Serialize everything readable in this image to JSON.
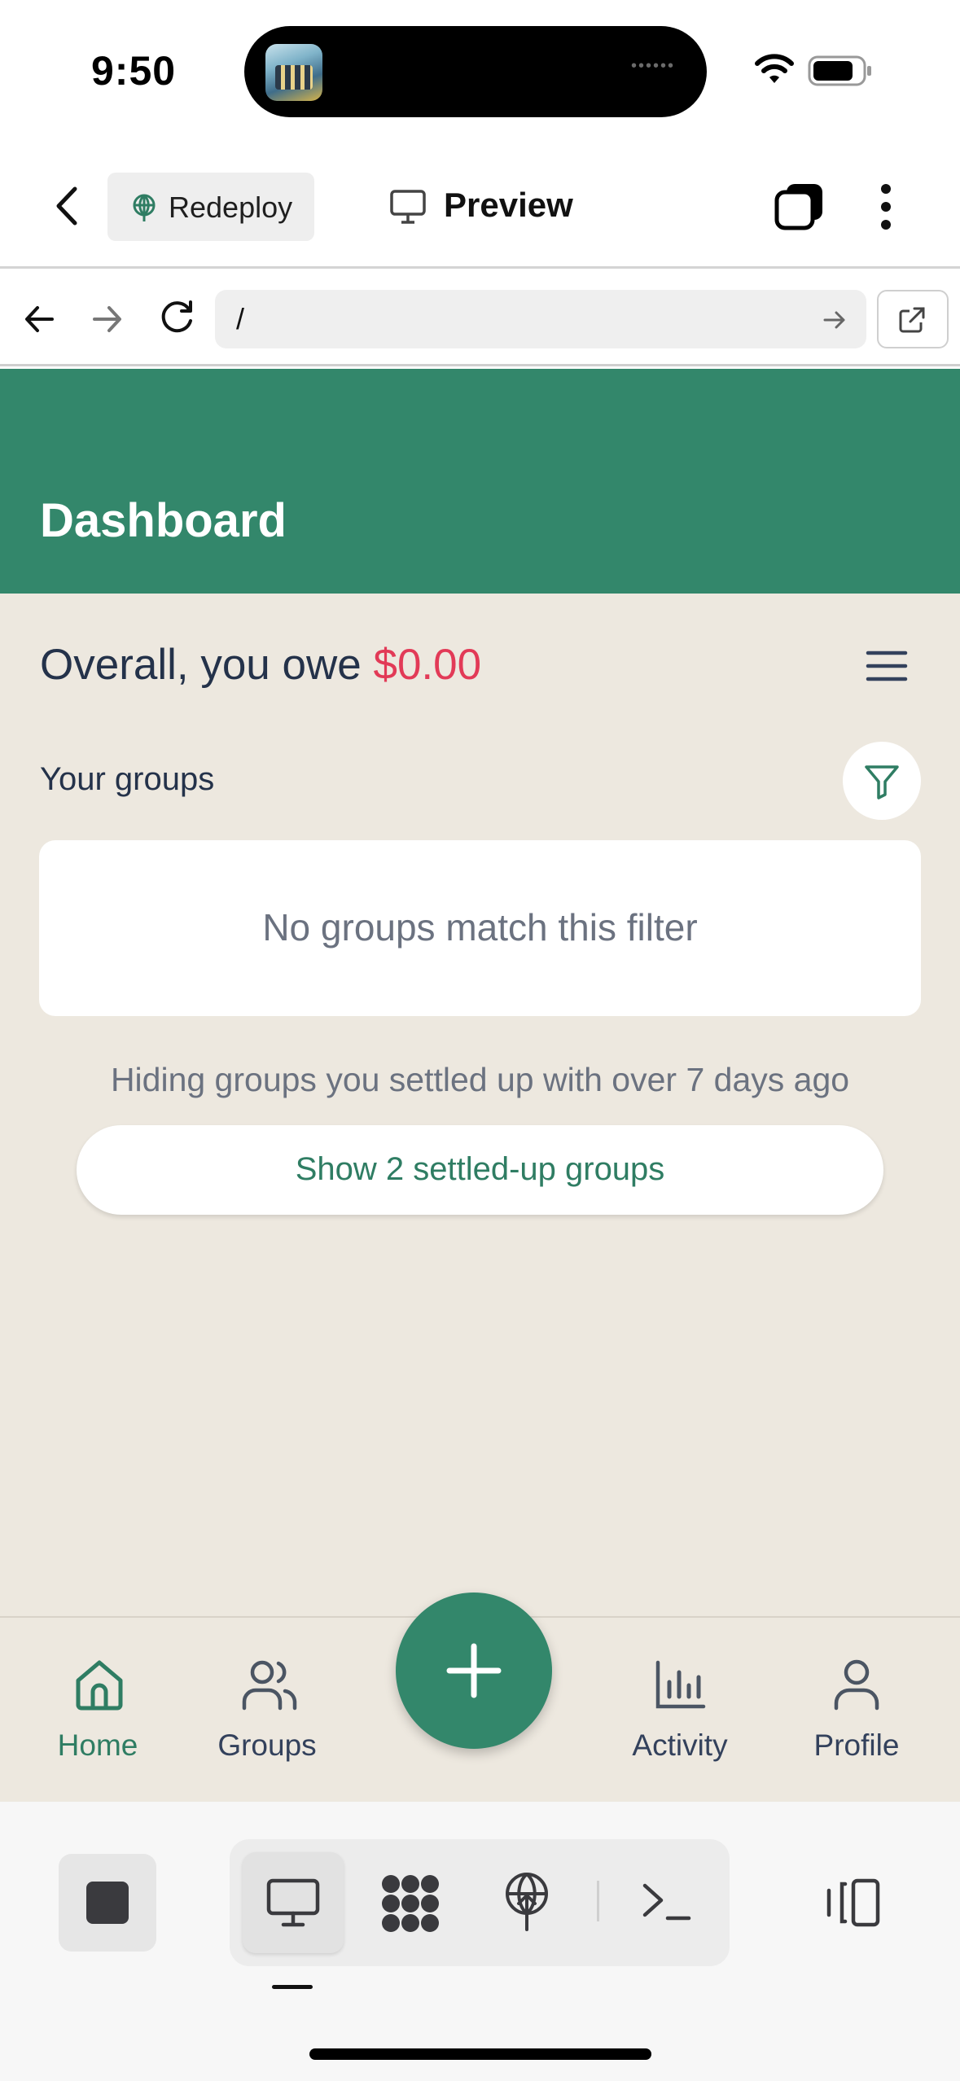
{
  "status_bar": {
    "time": "9:50"
  },
  "toolbar": {
    "redeploy_label": "Redeploy",
    "preview_label": "Preview"
  },
  "browser": {
    "url": "/"
  },
  "header": {
    "title": "Dashboard"
  },
  "summary": {
    "prefix": "Overall, you owe ",
    "amount": "$0.00"
  },
  "groups": {
    "heading": "Your groups",
    "empty_message": "No groups match this filter",
    "hiding_note": "Hiding groups you settled up with over 7 days ago",
    "show_settled_label": "Show 2 settled-up groups"
  },
  "bottom_nav": {
    "items": [
      {
        "label": "Home",
        "icon": "home-icon",
        "active": true
      },
      {
        "label": "Groups",
        "icon": "users-icon",
        "active": false
      },
      {
        "label": "Activity",
        "icon": "bar-chart-icon",
        "active": false
      },
      {
        "label": "Profile",
        "icon": "user-icon",
        "active": false
      }
    ]
  },
  "colors": {
    "brand": "#33876b",
    "owe_amount": "#e23a57",
    "background": "#ede8df",
    "active_nav": "#2f7d63"
  }
}
